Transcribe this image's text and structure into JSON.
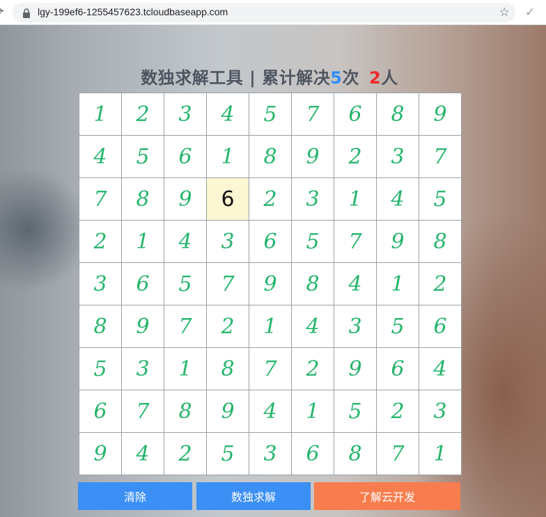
{
  "browser": {
    "url": "lgy-199ef6-1255457623.tcloudbaseapp.com",
    "icons": [
      "reload-icon",
      "lock-icon",
      "star-icon",
      "check-icon"
    ]
  },
  "title": {
    "prefix": "数独求解工具 | 累计解决",
    "solved_count": "5",
    "solved_unit": "次",
    "user_count": "2",
    "user_unit": "人",
    "colors": {
      "text": "#4f5560",
      "solved_count": "#2f8ef7",
      "user_count": "#f22a2a"
    }
  },
  "board": {
    "grid": [
      [
        "1",
        "2",
        "3",
        "4",
        "5",
        "7",
        "6",
        "8",
        "9"
      ],
      [
        "4",
        "5",
        "6",
        "1",
        "8",
        "9",
        "2",
        "3",
        "7"
      ],
      [
        "7",
        "8",
        "9",
        "6",
        "2",
        "3",
        "1",
        "4",
        "5"
      ],
      [
        "2",
        "1",
        "4",
        "3",
        "6",
        "5",
        "7",
        "9",
        "8"
      ],
      [
        "3",
        "6",
        "5",
        "7",
        "9",
        "8",
        "4",
        "1",
        "2"
      ],
      [
        "8",
        "9",
        "7",
        "2",
        "1",
        "4",
        "3",
        "5",
        "6"
      ],
      [
        "5",
        "3",
        "1",
        "8",
        "7",
        "2",
        "9",
        "6",
        "4"
      ],
      [
        "6",
        "7",
        "8",
        "9",
        "4",
        "1",
        "5",
        "2",
        "3"
      ],
      [
        "9",
        "4",
        "2",
        "5",
        "3",
        "6",
        "8",
        "7",
        "1"
      ]
    ],
    "given_cells": [
      [
        2,
        3
      ]
    ],
    "colors": {
      "solved_digit": "#26b56c",
      "given_digit": "#111111",
      "given_bg": "#fcf6d2"
    }
  },
  "buttons": {
    "clear": "清除",
    "solve": "数独求解",
    "learn": "了解云开发",
    "colors": {
      "primary": "#3b8ff5",
      "accent": "#f77d4e"
    }
  }
}
